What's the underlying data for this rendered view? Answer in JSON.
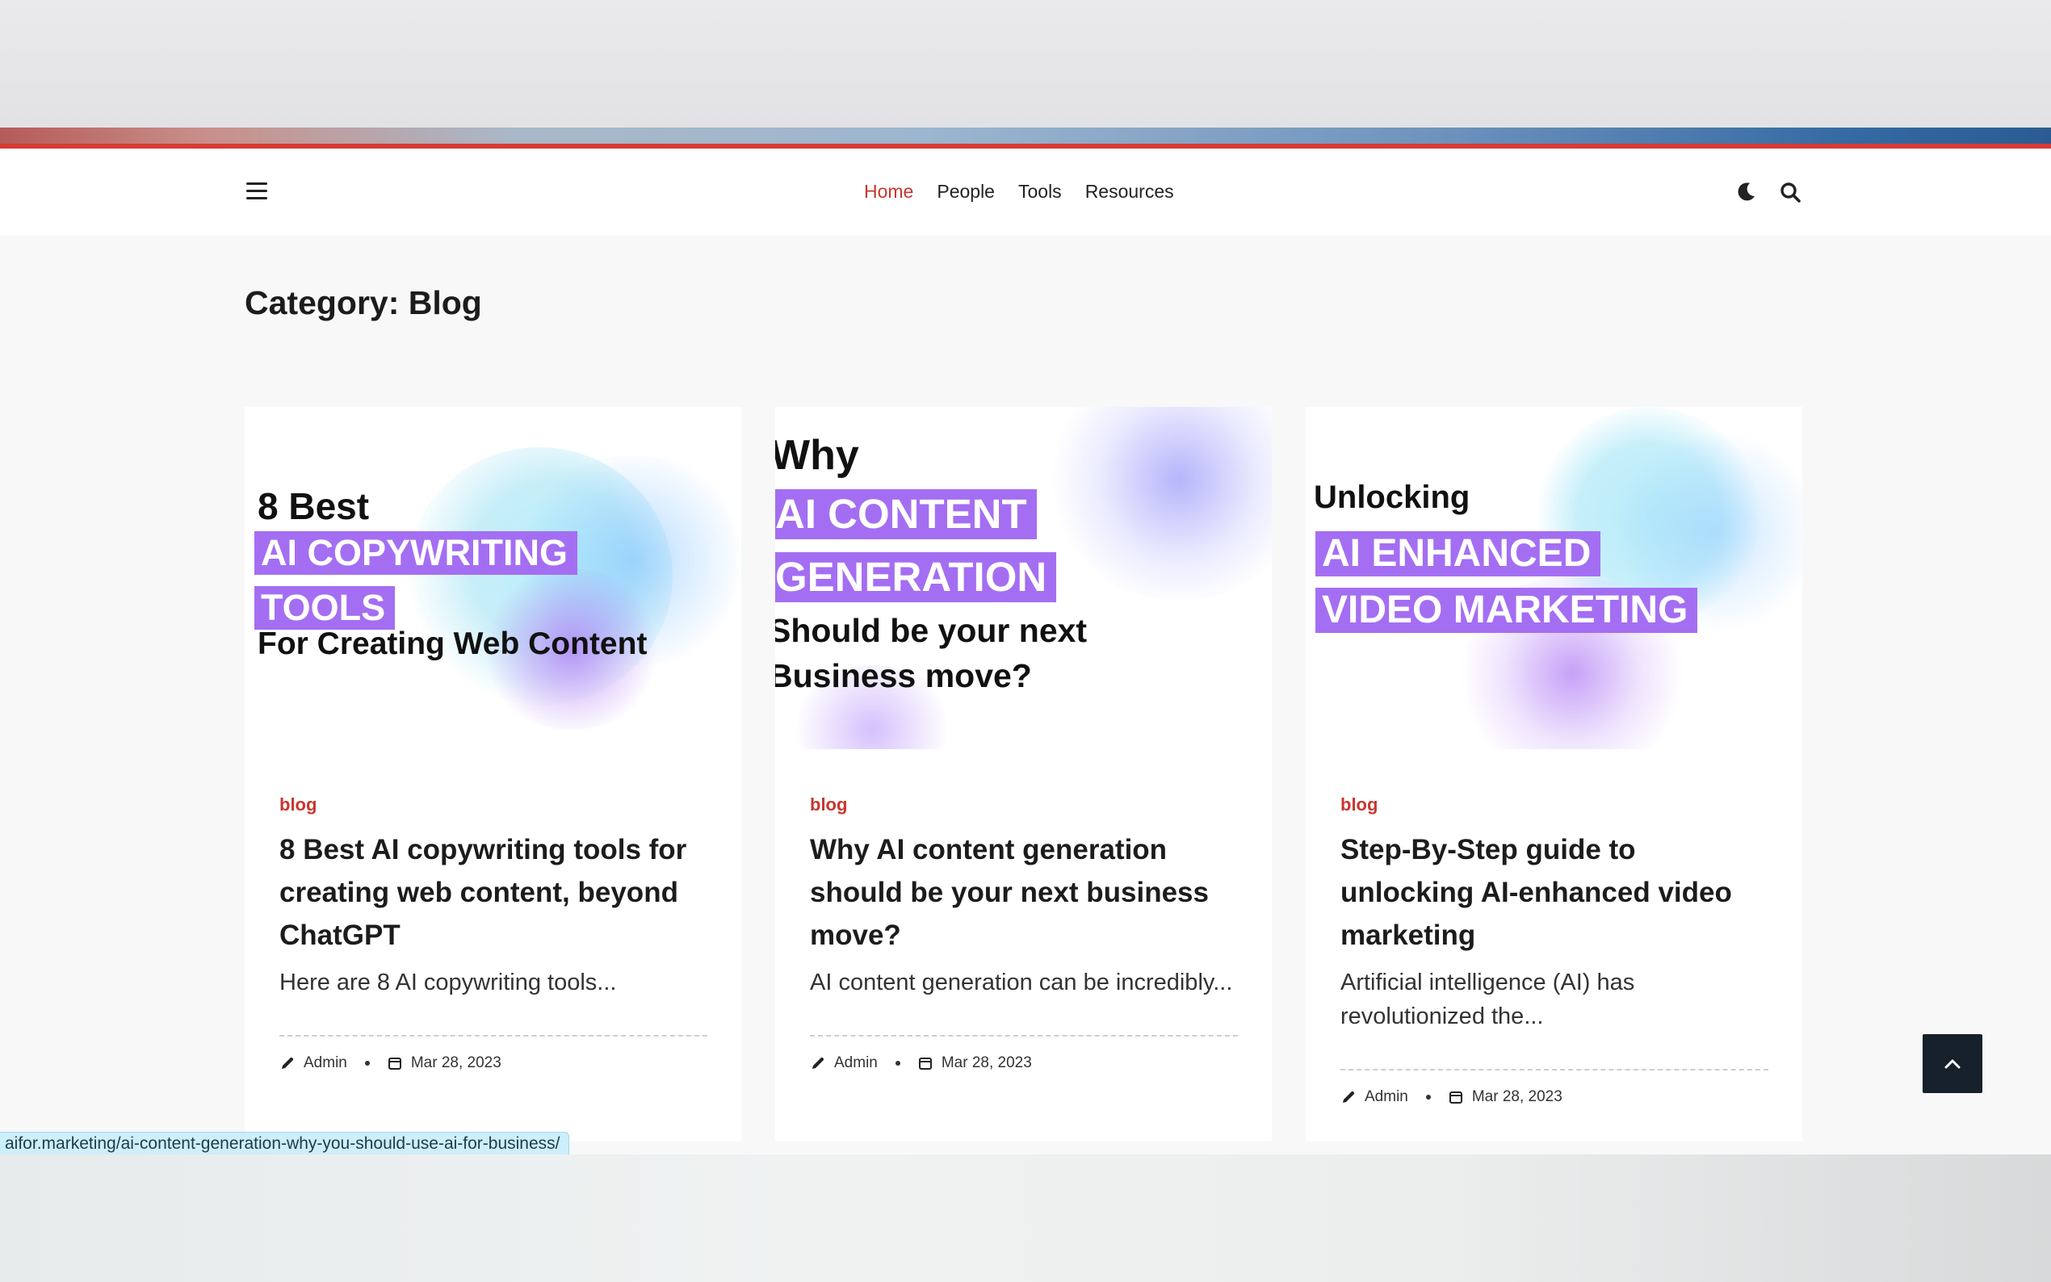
{
  "nav": {
    "items": [
      {
        "label": "Home",
        "active": true
      },
      {
        "label": "People",
        "active": false
      },
      {
        "label": "Tools",
        "active": false
      },
      {
        "label": "Resources",
        "active": false
      }
    ],
    "accent_color": "#c8362f"
  },
  "page": {
    "title": "Category: Blog"
  },
  "cards": [
    {
      "image_lines": [
        "8 Best",
        "AI COPYWRITING",
        "TOOLS",
        "For Creating Web Content"
      ],
      "category": "blog",
      "title": "8 Best AI copywriting tools for creating web content, beyond ChatGPT",
      "excerpt": "Here are 8 AI copywriting tools...",
      "author": "Admin",
      "date": "Mar 28, 2023"
    },
    {
      "image_lines": [
        "Why",
        "AI CONTENT",
        "GENERATION",
        "Should be your next",
        "Business move?"
      ],
      "category": "blog",
      "title": "Why AI content generation should be your next business move?",
      "excerpt": "AI content generation can be incredibly...",
      "author": "Admin",
      "date": "Mar 28, 2023"
    },
    {
      "image_lines": [
        "Unlocking",
        "AI ENHANCED",
        "VIDEO MARKETING"
      ],
      "category": "blog",
      "title": "Step-By-Step guide to unlocking AI-enhanced video marketing",
      "excerpt": "Artificial intelligence (AI) has revolutionized the...",
      "author": "Admin",
      "date": "Mar 28, 2023"
    }
  ],
  "status_bar": {
    "url": "aifor.marketing/ai-content-generation-why-you-should-use-ai-for-business/"
  },
  "icons": {
    "menu": "hamburger-icon",
    "theme": "moon-icon",
    "search": "search-icon",
    "author": "pen-icon",
    "date": "calendar-icon",
    "back_to_top": "chevron-up-icon"
  }
}
